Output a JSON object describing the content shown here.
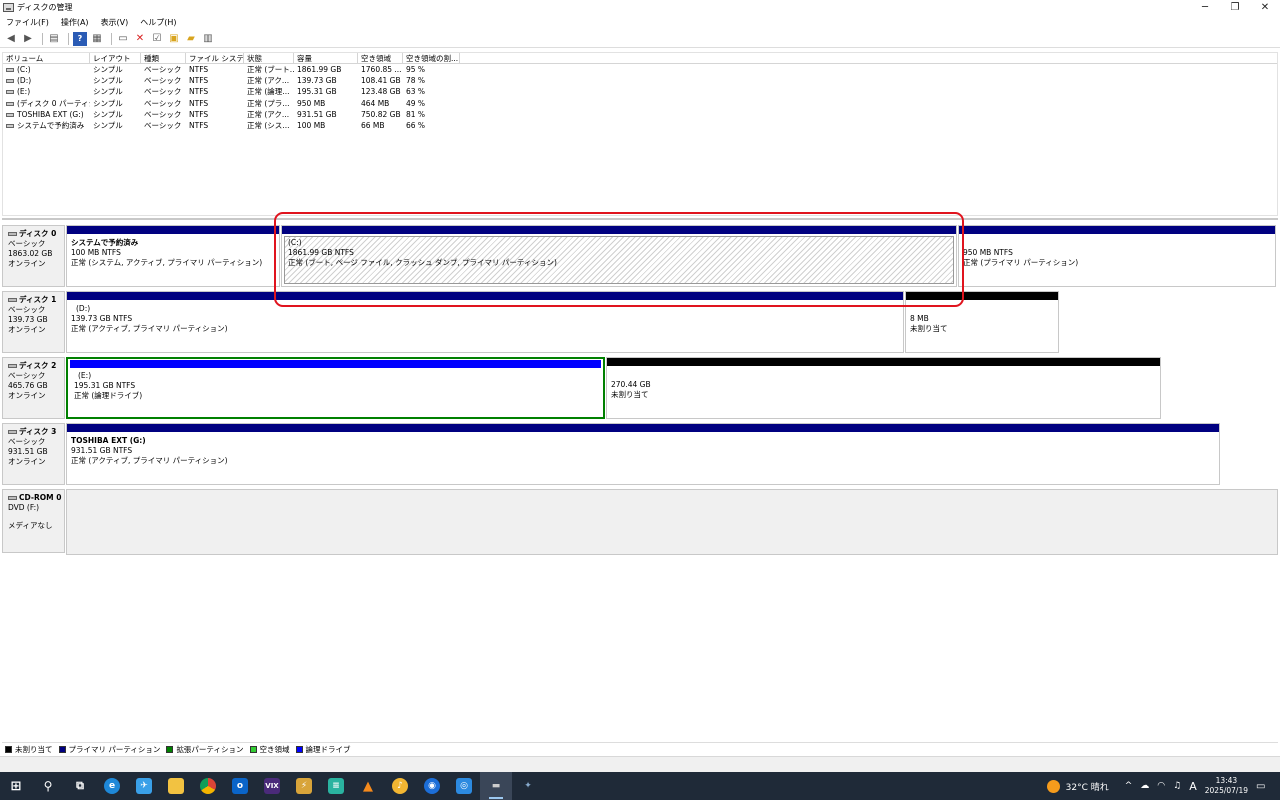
{
  "window": {
    "title": "ディスクの管理",
    "min": "─",
    "max": "❐",
    "close": "✕"
  },
  "menu": [
    "ファイル(F)",
    "操作(A)",
    "表示(V)",
    "ヘルプ(H)"
  ],
  "volumes": {
    "headers": [
      "ボリューム",
      "レイアウト",
      "種類",
      "ファイル システム",
      "状態",
      "容量",
      "空き領域",
      "空き領域の割..."
    ],
    "rows": [
      [
        "(C:)",
        "シンプル",
        "ベーシック",
        "NTFS",
        "正常 (ブート...",
        "1861.99 GB",
        "1760.85 ...",
        "95 %"
      ],
      [
        "(D:)",
        "シンプル",
        "ベーシック",
        "NTFS",
        "正常 (アク...",
        "139.73 GB",
        "108.41 GB",
        "78 %"
      ],
      [
        "(E:)",
        "シンプル",
        "ベーシック",
        "NTFS",
        "正常 (論理...",
        "195.31 GB",
        "123.48 GB",
        "63 %"
      ],
      [
        "(ディスク 0 パーティシ...",
        "シンプル",
        "ベーシック",
        "NTFS",
        "正常 (プラ...",
        "950 MB",
        "464 MB",
        "49 %"
      ],
      [
        "TOSHIBA EXT (G:)",
        "シンプル",
        "ベーシック",
        "NTFS",
        "正常 (アク...",
        "931.51 GB",
        "750.82 GB",
        "81 %"
      ],
      [
        "システムで予約済み",
        "シンプル",
        "ベーシック",
        "NTFS",
        "正常 (シス...",
        "100 MB",
        "66 MB",
        "66 %"
      ]
    ]
  },
  "disks": [
    {
      "name": "ディスク 0",
      "type": "ベーシック",
      "size": "1863.02 GB",
      "status": "オンライン",
      "parts": [
        {
          "name": "システムで予約済み",
          "size": "100 MB NTFS",
          "status": "正常 (システム, アクティブ, プライマリ パーティション)"
        },
        {
          "name": "(C:)",
          "size": "1861.99 GB NTFS",
          "status": "正常 (ブート, ページ ファイル, クラッシュ ダンプ, プライマリ パーティション)"
        },
        {
          "name": "",
          "size": "950 MB NTFS",
          "status": "正常 (プライマリ パーティション)"
        }
      ]
    },
    {
      "name": "ディスク 1",
      "type": "ベーシック",
      "size": "139.73 GB",
      "status": "オンライン",
      "parts": [
        {
          "name": "(D:)",
          "size": "139.73 GB NTFS",
          "status": "正常 (アクティブ, プライマリ パーティション)"
        },
        {
          "name": "",
          "size": "8 MB",
          "status": "未割り当て"
        }
      ]
    },
    {
      "name": "ディスク 2",
      "type": "ベーシック",
      "size": "465.76 GB",
      "status": "オンライン",
      "parts": [
        {
          "name": "(E:)",
          "size": "195.31 GB NTFS",
          "status": "正常 (論理ドライブ)"
        },
        {
          "name": "",
          "size": "270.44 GB",
          "status": "未割り当て"
        }
      ]
    },
    {
      "name": "ディスク 3",
      "type": "ベーシック",
      "size": "931.51 GB",
      "status": "オンライン",
      "parts": [
        {
          "name": "TOSHIBA EXT  (G:)",
          "size": "931.51 GB NTFS",
          "status": "正常 (アクティブ, プライマリ パーティション)"
        }
      ]
    }
  ],
  "cdrom": {
    "name": "CD-ROM 0",
    "type": "DVD (F:)",
    "status": "メディアなし"
  },
  "legend": [
    {
      "label": "未割り当て",
      "color": "#000000"
    },
    {
      "label": "プライマリ パーティション",
      "color": "#000080"
    },
    {
      "label": "拡張パーティション",
      "color": "#008000"
    },
    {
      "label": "空き領域",
      "color": "#33cc33"
    },
    {
      "label": "論理ドライブ",
      "color": "#0000ff"
    }
  ],
  "colors": {
    "primary": "#000080",
    "unallocated": "#000000",
    "logical": "#0000ff",
    "extended": "#008000",
    "highlight": "#e0141e"
  },
  "taskbar": {
    "weather": "32°C 晴れ",
    "ime": "A",
    "time": "13:43",
    "date": "2025/07/19"
  }
}
